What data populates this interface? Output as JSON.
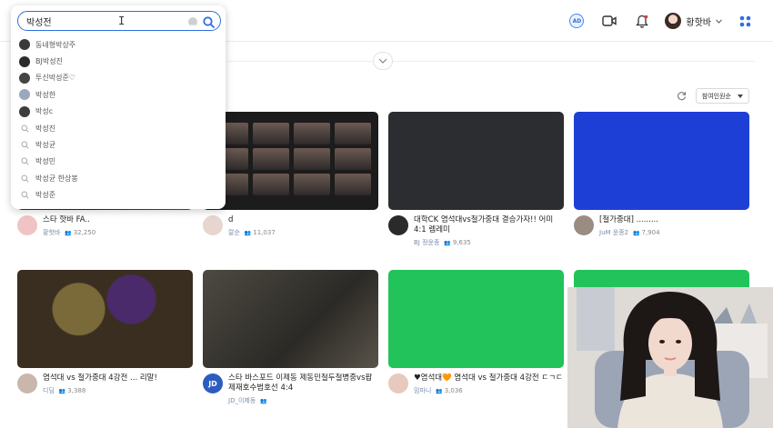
{
  "header": {
    "ad_label": "AD",
    "user_name": "황핫바"
  },
  "search": {
    "query": "박성전",
    "suggestions": [
      {
        "label": "동네형박상주",
        "kind": "channel"
      },
      {
        "label": "BJ박성진",
        "kind": "channel"
      },
      {
        "label": "투신박성준♡",
        "kind": "channel"
      },
      {
        "label": "박성한",
        "kind": "channel"
      },
      {
        "label": "박성c",
        "kind": "channel"
      },
      {
        "label": "박성진",
        "kind": "keyword"
      },
      {
        "label": "박성균",
        "kind": "keyword"
      },
      {
        "label": "박성민",
        "kind": "keyword"
      },
      {
        "label": "박성균 한상봉",
        "kind": "keyword"
      },
      {
        "label": "박성준",
        "kind": "keyword"
      }
    ]
  },
  "sort": {
    "selected": "참여인원순"
  },
  "cards": [
    {
      "title": "스타 핫바 FA..",
      "channel": "황핫바",
      "views": "32,250",
      "avatar_color": "#f0c4c4"
    },
    {
      "title": "d",
      "channel": "랄순",
      "views": "11,037",
      "avatar_color": "#e6d6cf"
    },
    {
      "title": "대학CK 염석대vs철가중대 결승가자!! 어미 4:1 렘레미",
      "channel": "BJ 정윤종",
      "views": "9,635",
      "avatar_color": "#2a2a2a"
    },
    {
      "title": "[철가중대] .........",
      "channel": "JuM 윤종2",
      "views": "7,904",
      "avatar_color": "#9a8c80"
    },
    {
      "title": "염석대 vs 철가중대 4강전 ... 리말!",
      "channel": "디딤",
      "views": "3,388",
      "avatar_color": "#c9b6ac"
    },
    {
      "title": "스타 바스포드 이제동 제동민철두철병중vs팝제재호수범호선 4:4",
      "channel": "JD_이제동",
      "views": "",
      "avatar_color": "#2d5cbf",
      "avatar_text": "JD"
    },
    {
      "title": "♥염석대🧡 염석대 vs 철가중대 4강전 ㄷㄱㄷ",
      "channel": "밈마니",
      "views": "3,036",
      "avatar_color": "#e7c9be"
    },
    {
      "title": "",
      "channel": "",
      "views": "",
      "avatar_color": "#ffffff"
    }
  ]
}
